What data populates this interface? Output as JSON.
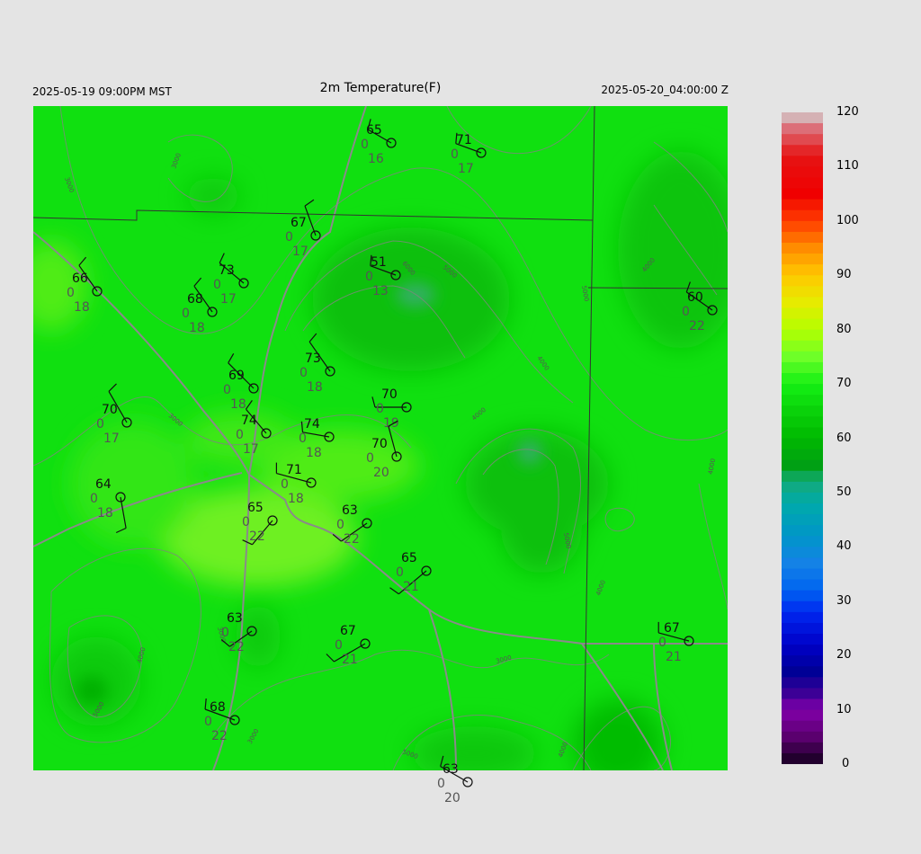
{
  "header": {
    "local_time": "2025-05-19 09:00PM MST",
    "title": "2m Temperature(F)",
    "utc_time": "2025-05-20_04:00:00 Z"
  },
  "colorbar": {
    "labels": [
      "120",
      "110",
      "100",
      "90",
      "80",
      "70",
      "60",
      "50",
      "40",
      "30",
      "20",
      "10",
      "0"
    ],
    "range": [
      0,
      120
    ]
  },
  "contour_labels": [
    "3000",
    "4000",
    "5000",
    "6000"
  ],
  "stations": [
    {
      "t": "65",
      "d": "0",
      "v": "16",
      "temp": 65
    },
    {
      "t": "71",
      "d": "0",
      "v": "17",
      "temp": 71
    },
    {
      "t": "67",
      "d": "0",
      "v": "17",
      "temp": 67
    },
    {
      "t": "51",
      "d": "0",
      "v": "13",
      "temp": 51
    },
    {
      "t": "66",
      "d": "0",
      "v": "18",
      "temp": 66
    },
    {
      "t": "73",
      "d": "0",
      "v": "17",
      "temp": 73
    },
    {
      "t": "68",
      "d": "0",
      "v": "18",
      "temp": 68
    },
    {
      "t": "60",
      "d": "0",
      "v": "22",
      "temp": 60
    },
    {
      "t": "73",
      "d": "0",
      "v": "18",
      "temp": 73
    },
    {
      "t": "69",
      "d": "0",
      "v": "18",
      "temp": 69
    },
    {
      "t": "70",
      "d": "0",
      "v": "19",
      "temp": 70
    },
    {
      "t": "70",
      "d": "0",
      "v": "17",
      "temp": 70
    },
    {
      "t": "74",
      "d": "0",
      "v": "17",
      "temp": 74
    },
    {
      "t": "74",
      "d": "0",
      "v": "18",
      "temp": 74
    },
    {
      "t": "70",
      "d": "0",
      "v": "20",
      "temp": 70
    },
    {
      "t": "71",
      "d": "0",
      "v": "18",
      "temp": 71
    },
    {
      "t": "64",
      "d": "0",
      "v": "18",
      "temp": 64
    },
    {
      "t": "65",
      "d": "0",
      "v": "22",
      "temp": 65
    },
    {
      "t": "63",
      "d": "0",
      "v": "22",
      "temp": 63
    },
    {
      "t": "65",
      "d": "0",
      "v": "21",
      "temp": 65
    },
    {
      "t": "63",
      "d": "0",
      "v": "22",
      "temp": 63
    },
    {
      "t": "67",
      "d": "0",
      "v": "21",
      "temp": 67
    },
    {
      "t": "67",
      "d": "0",
      "v": "21",
      "temp": 67
    },
    {
      "t": "68",
      "d": "0",
      "v": "22",
      "temp": 68
    },
    {
      "t": "63",
      "d": "0",
      "v": "20",
      "temp": 63
    }
  ]
}
